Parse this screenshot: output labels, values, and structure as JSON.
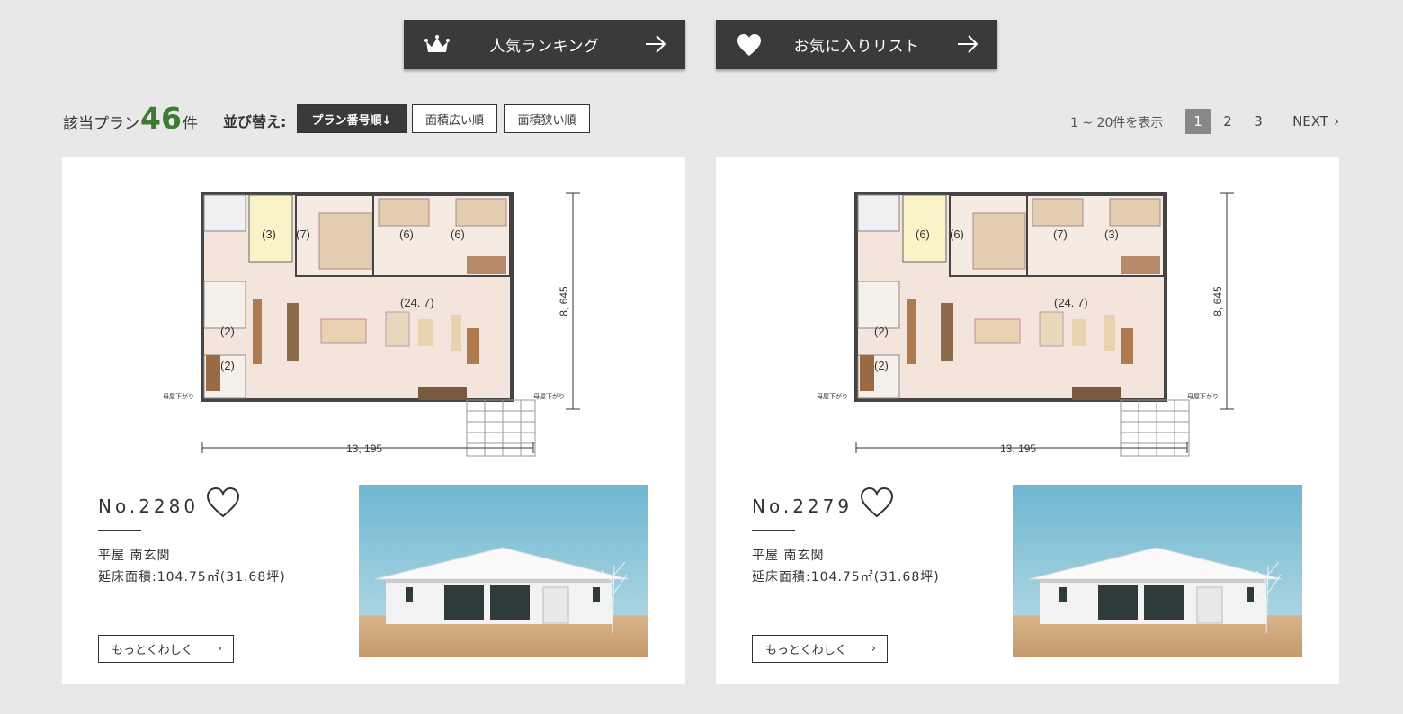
{
  "top_nav": {
    "ranking_label": "人気ランキング",
    "favorites_label": "お気に入りリスト"
  },
  "results": {
    "prefix": "該当プラン",
    "count": "46",
    "suffix": "件"
  },
  "sort": {
    "label": "並び替え:",
    "options": [
      "プラン番号順↓",
      "面積広い順",
      "面積狭い順"
    ],
    "active": "プラン番号順↓"
  },
  "pagination": {
    "range": "1 ~ 20件を表示",
    "pages": [
      "1",
      "2",
      "3"
    ],
    "current": "1",
    "next": "NEXT"
  },
  "cards": [
    {
      "plan_no": "No.2280",
      "type": "平屋 南玄関",
      "area": "延床面積:104.75㎡(31.68坪)",
      "more": "もっとくわしく",
      "dim_width": "13, 195",
      "dim_height": "8, 645",
      "rooms": [
        "(3)",
        "(7)",
        "(6)",
        "(6)",
        "(24. 7)",
        "(2)",
        "(2)"
      ],
      "eave_label": "母屋下がり"
    },
    {
      "plan_no": "No.2279",
      "type": "平屋 南玄関",
      "area": "延床面積:104.75㎡(31.68坪)",
      "more": "もっとくわしく",
      "dim_width": "13, 195",
      "dim_height": "8, 645",
      "rooms": [
        "(6)",
        "(6)",
        "(7)",
        "(3)",
        "(24. 7)",
        "(2)",
        "(2)"
      ],
      "eave_label": "母屋下がり"
    }
  ],
  "colors": {
    "accent_green": "#3e7a33",
    "button_dark": "#3a3a3a",
    "background": "#e8e8e8"
  }
}
